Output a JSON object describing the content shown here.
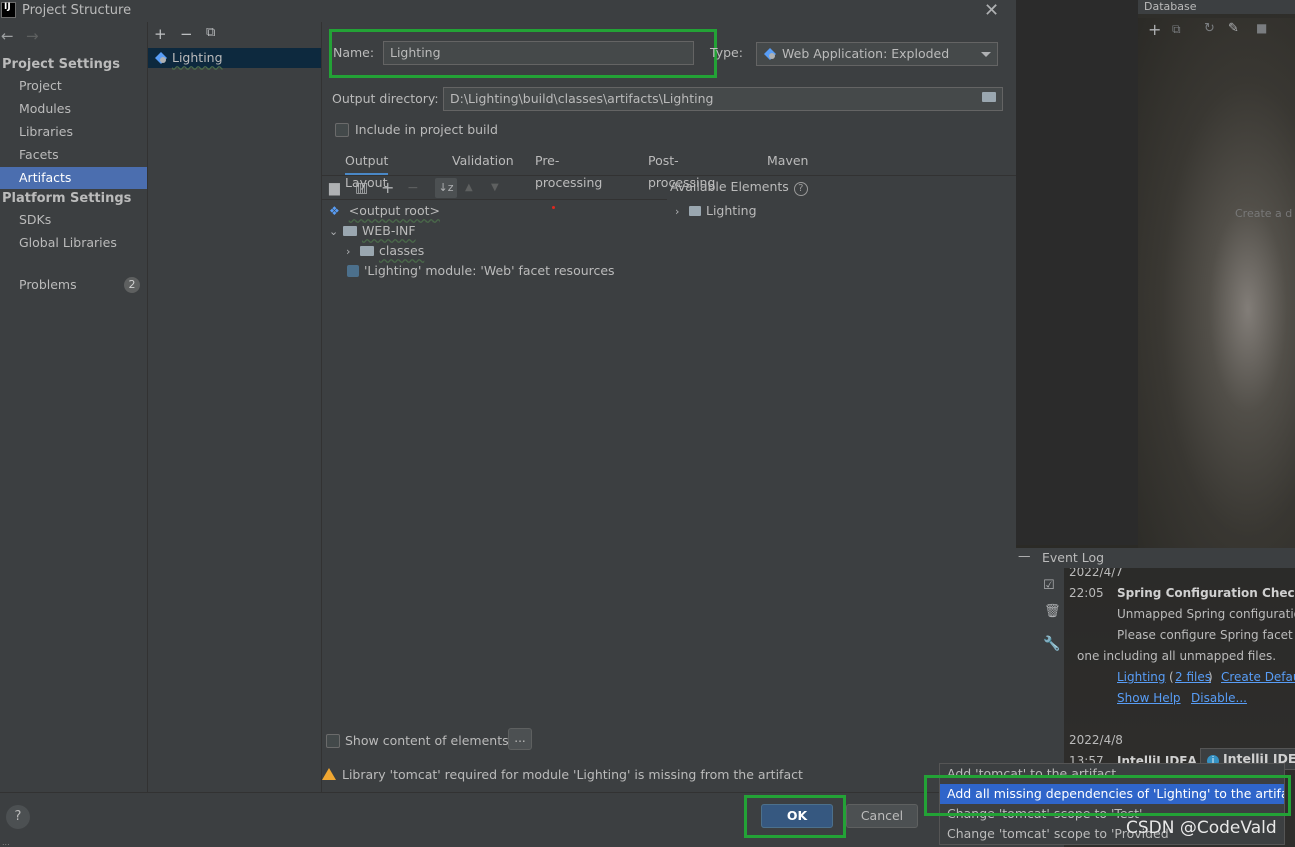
{
  "window": {
    "title": "Project Structure",
    "app_icon_text": "IJ"
  },
  "nav": {
    "back_icon": "←",
    "forward_icon": "→",
    "project_settings_header": "Project Settings",
    "project_items": [
      "Project",
      "Modules",
      "Libraries",
      "Facets",
      "Artifacts"
    ],
    "selected": "Artifacts",
    "platform_settings_header": "Platform Settings",
    "platform_items": [
      "SDKs",
      "Global Libraries"
    ],
    "problems_label": "Problems",
    "problems_count": "2"
  },
  "artifact_list": {
    "toolbar": [
      "+",
      "−",
      "⧉"
    ],
    "items": [
      "Lighting"
    ]
  },
  "form": {
    "name_label": "Name:",
    "name_value": "Lighting",
    "type_label": "Type:",
    "type_value": "Web Application: Exploded",
    "output_dir_label": "Output directory:",
    "output_dir_value": "D:\\Lighting\\build\\classes\\artifacts\\Lighting",
    "include_in_build_label": "Include in project build",
    "include_in_build_checked": false
  },
  "tabs": [
    "Output Layout",
    "Validation",
    "Pre-processing",
    "Post-processing",
    "Maven"
  ],
  "active_tab": "Output Layout",
  "output_layout": {
    "tree": [
      {
        "label": "<output root>"
      },
      {
        "label": "WEB-INF"
      },
      {
        "label": "classes"
      },
      {
        "label": "'Lighting' module: 'Web' facet resources"
      }
    ],
    "available_elements_label": "Available Elements",
    "available_elements": [
      "Lighting"
    ],
    "show_content_label": "Show content of elements",
    "show_content_checked": false,
    "ellipsis_label": "..."
  },
  "warning": "Library 'tomcat' required for module 'Lighting' is missing from the artifact",
  "buttons": {
    "ok": "OK",
    "cancel": "Cancel",
    "help": "?"
  },
  "statusbar": "...",
  "database_panel": {
    "title": "Database",
    "hint": "Create a d"
  },
  "event_log": {
    "title": "Event Log",
    "entries": [
      {
        "date": "2022/4/7",
        "time": "22:05",
        "title": "Spring Configuration Check",
        "lines": [
          "Unmapped Spring configuratio",
          "Please configure Spring facet o",
          "one including all unmapped files."
        ],
        "links": [
          "Lighting",
          "2 files",
          "Create Defau",
          "Show Help",
          "Disable..."
        ]
      },
      {
        "date": "2022/4/8",
        "time": "13:57",
        "title": "IntelliJ IDEA"
      }
    ],
    "notification": "IntelliJ IDE"
  },
  "popup_menu": {
    "items": [
      "Add 'tomcat' to the artifact",
      "Add all missing dependencies of 'Lighting' to the artifact",
      "Change 'tomcat' scope to 'Test'",
      "Change 'tomcat' scope to 'Provided'"
    ],
    "selected_index": 1
  },
  "watermark": "CSDN @CodeVald",
  "colors": {
    "accent": "#4b6eaf",
    "highlight_box": "#23a236",
    "link": "#589df6",
    "warning": "#f0a732"
  }
}
